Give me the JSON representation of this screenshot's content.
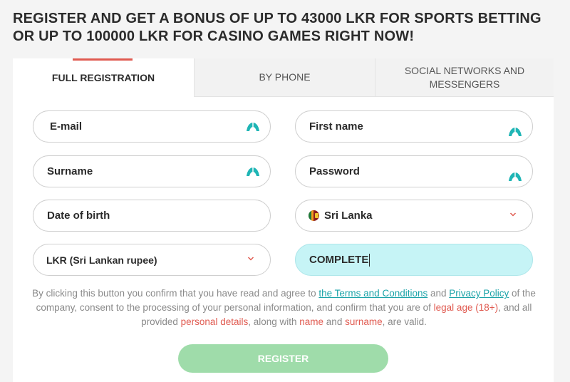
{
  "headline": "REGISTER AND GET A BONUS OF UP TO 43000 LKR FOR SPORTS BETTING OR UP TO 100000 LKR FOR CASINO GAMES RIGHT NOW!",
  "tabs": [
    {
      "label": "FULL REGISTRATION",
      "active": true
    },
    {
      "label": "BY PHONE",
      "active": false
    },
    {
      "label": "SOCIAL NETWORKS AND MESSENGERS",
      "active": false
    }
  ],
  "form": {
    "email_placeholder": "E-mail",
    "first_name_placeholder": "First name",
    "surname_placeholder": "Surname",
    "password_placeholder": "Password",
    "dob_placeholder": "Date of birth",
    "country_value": "Sri Lanka",
    "currency_value": "LKR (Sri Lankan rupee)",
    "promo_value": "COMPLETE"
  },
  "consent": {
    "t1": "By clicking this button you confirm that you have read and agree to ",
    "terms_link": "the Terms and Conditions",
    "t2": " and ",
    "privacy_link": "Privacy Policy",
    "t3": " of the company, consent to the processing of your personal information, and confirm that you are of ",
    "legal_age": "legal age (18+)",
    "t4": ", and all provided ",
    "personal_details": "personal details",
    "t5": ", along with ",
    "name": "name",
    "t6": " and ",
    "surname": "surname",
    "t7": ", are valid."
  },
  "register_label": "REGISTER",
  "colors": {
    "accent_red": "#e05a50",
    "link_teal": "#1aa3a8",
    "register_green": "#9fdcaa",
    "promo_bg": "#c6f4f6",
    "icon_teal": "#1fb5b5"
  },
  "icons": {
    "password_manager": "password-manager-icon",
    "dropdown": "chevron-down-icon",
    "flag": "sri-lanka-flag-icon"
  }
}
